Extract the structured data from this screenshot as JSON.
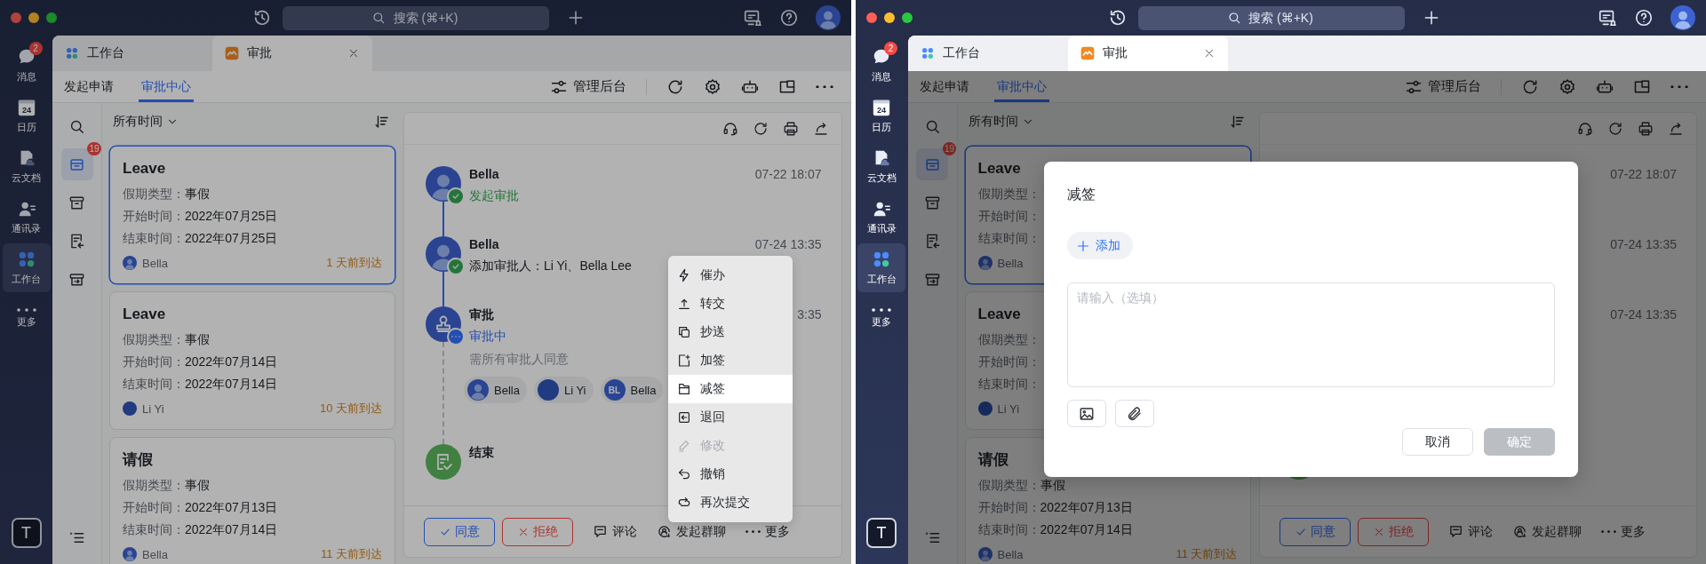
{
  "windows": [
    {
      "search": {
        "placeholder": "搜索 (⌘+K)"
      },
      "sidebar": [
        {
          "kind": "chat",
          "label": "消息",
          "badge": "2",
          "selected": false
        },
        {
          "kind": "calendar",
          "label": "日历",
          "date": "24",
          "selected": false
        },
        {
          "kind": "doc",
          "label": "云文档",
          "selected": false
        },
        {
          "kind": "contacts",
          "label": "通讯录",
          "selected": false
        },
        {
          "kind": "workspace",
          "label": "工作台",
          "selected": true
        },
        {
          "kind": "more",
          "label": "更多",
          "selected": false
        }
      ],
      "user_tile": "T",
      "tabs": [
        {
          "kind": "workspace",
          "label": "工作台",
          "selected": false
        },
        {
          "kind": "approval",
          "label": "审批",
          "selected": true,
          "closable": true
        }
      ],
      "subnav": [
        {
          "label": "发起申请",
          "selected": false
        },
        {
          "label": "审批中心",
          "selected": true
        }
      ],
      "admin_button": "管理后台",
      "tool_column": [
        {
          "kind": "search",
          "selected": false
        },
        {
          "kind": "inbox",
          "selected": true,
          "badge": "19"
        },
        {
          "kind": "archive",
          "selected": false
        },
        {
          "kind": "returned",
          "selected": false
        },
        {
          "kind": "sent",
          "selected": false
        }
      ],
      "filter": "所有时间",
      "cards": [
        {
          "title": "Leave",
          "selected": true,
          "fields": [
            {
              "label": "假期类型：",
              "value": "事假"
            },
            {
              "label": "开始时间：",
              "value": "2022年07月25日"
            },
            {
              "label": "结束时间：",
              "value": "2022年07月25日"
            }
          ],
          "user": {
            "name": "Bella",
            "kind": "photo"
          },
          "arrival": "1 天前到达"
        },
        {
          "title": "Leave",
          "selected": false,
          "fields": [
            {
              "label": "假期类型：",
              "value": "事假"
            },
            {
              "label": "开始时间：",
              "value": "2022年07月14日"
            },
            {
              "label": "结束时间：",
              "value": "2022年07月14日"
            }
          ],
          "user": {
            "name": "Li Yi",
            "kind": "plain"
          },
          "arrival": "10 天前到达"
        },
        {
          "title": "请假",
          "selected": false,
          "fields": [
            {
              "label": "假期类型：",
              "value": "事假"
            },
            {
              "label": "开始时间：",
              "value": "2022年07月13日"
            },
            {
              "label": "结束时间：",
              "value": "2022年07月14日"
            }
          ],
          "user": {
            "name": "Bella",
            "kind": "photo"
          },
          "arrival": "11 天前到达"
        }
      ],
      "timeline": [
        {
          "kind": "person",
          "done": true,
          "name": "Bella",
          "status": "发起审批",
          "time": "07-22 18:07"
        },
        {
          "kind": "person",
          "done": true,
          "name": "Bella",
          "detail": "添加审批人：Li Yi、Bella Lee",
          "time": "07-24 13:35"
        },
        {
          "kind": "stamp",
          "done": false,
          "name": "审批",
          "status": "审批中",
          "time": "3:35",
          "note": "需所有审批人同意",
          "approvers": [
            {
              "name": "Bella",
              "kind": "photo"
            },
            {
              "name": "Li Yi",
              "kind": "plain"
            },
            {
              "name": "Bella",
              "kind": "initials",
              "initials": "BL"
            }
          ]
        },
        {
          "kind": "end",
          "name": "结束"
        }
      ],
      "actions": {
        "approve": "同意",
        "reject": "拒绝",
        "links": [
          {
            "kind": "comment",
            "label": "评论"
          },
          {
            "kind": "group",
            "label": "发起群聊"
          },
          {
            "kind": "more",
            "label": "更多"
          }
        ]
      },
      "overlay": {
        "kind": "menu",
        "items": [
          {
            "kind": "urge",
            "label": "催办",
            "selected": false,
            "disabled": false
          },
          {
            "kind": "transfer",
            "label": "转交",
            "selected": false,
            "disabled": false
          },
          {
            "kind": "copy",
            "label": "抄送",
            "selected": false,
            "disabled": false
          },
          {
            "kind": "add",
            "label": "加签",
            "selected": false,
            "disabled": false
          },
          {
            "kind": "remove",
            "label": "减签",
            "selected": true,
            "disabled": false
          },
          {
            "kind": "back",
            "label": "退回",
            "selected": false,
            "disabled": false
          },
          {
            "kind": "edit",
            "label": "修改",
            "selected": false,
            "disabled": true
          },
          {
            "kind": "undo",
            "label": "撤销",
            "selected": false,
            "disabled": false
          },
          {
            "kind": "resubmit",
            "label": "再次提交",
            "selected": false,
            "disabled": false
          }
        ]
      }
    },
    {
      "search": {
        "placeholder": "搜索 (⌘+K)"
      },
      "sidebar": [
        {
          "kind": "chat",
          "label": "消息",
          "badge": "2",
          "selected": false
        },
        {
          "kind": "calendar",
          "label": "日历",
          "date": "24",
          "selected": false
        },
        {
          "kind": "doc",
          "label": "云文档",
          "selected": false
        },
        {
          "kind": "contacts",
          "label": "通讯录",
          "selected": false
        },
        {
          "kind": "workspace",
          "label": "工作台",
          "selected": true
        },
        {
          "kind": "more",
          "label": "更多",
          "selected": false
        }
      ],
      "user_tile": "T",
      "tabs": [
        {
          "kind": "workspace",
          "label": "工作台",
          "selected": false
        },
        {
          "kind": "approval",
          "label": "审批",
          "selected": true,
          "closable": true
        }
      ],
      "subnav": [
        {
          "label": "发起申请",
          "selected": false
        },
        {
          "label": "审批中心",
          "selected": true
        }
      ],
      "admin_button": "管理后台",
      "tool_column": [
        {
          "kind": "search",
          "selected": false
        },
        {
          "kind": "inbox",
          "selected": true,
          "badge": "19"
        },
        {
          "kind": "archive",
          "selected": false
        },
        {
          "kind": "returned",
          "selected": false
        },
        {
          "kind": "sent",
          "selected": false
        }
      ],
      "filter": "所有时间",
      "cards": [
        {
          "title": "Leave",
          "selected": true,
          "fields": [
            {
              "label": "假期类型："
            },
            {
              "label": "开始时间："
            },
            {
              "label": "结束时间："
            }
          ],
          "user": {
            "name": "Bella",
            "kind": "photo"
          }
        },
        {
          "title": "Leave",
          "selected": false,
          "fields": [
            {
              "label": "假期类型："
            },
            {
              "label": "开始时间："
            },
            {
              "label": "结束时间："
            }
          ],
          "user": {
            "name": "Li Yi",
            "kind": "plain"
          }
        },
        {
          "title": "请假",
          "selected": false,
          "fields": [
            {
              "label": "假期类型：",
              "value": "事假"
            },
            {
              "label": "开始时间：",
              "value": "2022年07月13日"
            },
            {
              "label": "结束时间：",
              "value": "2022年07月14日"
            }
          ],
          "user": {
            "name": "Bella",
            "kind": "photo"
          },
          "arrival": "11 天前到达"
        }
      ],
      "timeline": [
        {
          "kind": "person",
          "time": "07-22 18:07"
        },
        {
          "kind": "person",
          "time": "07-24 13:35"
        },
        {
          "kind": "stamp",
          "time": "07-24 13:35"
        },
        {
          "kind": "end"
        }
      ],
      "actions": {
        "approve": "同意",
        "reject": "拒绝",
        "links": [
          {
            "kind": "comment",
            "label": "评论"
          },
          {
            "kind": "group",
            "label": "发起群聊"
          },
          {
            "kind": "more",
            "label": "更多"
          }
        ]
      },
      "overlay": {
        "kind": "dialog",
        "title": "减签",
        "add_button": "添加",
        "comment": {
          "placeholder": "请输入（选填）"
        },
        "cancel": "取消",
        "confirm": {
          "label": "确定",
          "disabled": true
        }
      }
    }
  ]
}
